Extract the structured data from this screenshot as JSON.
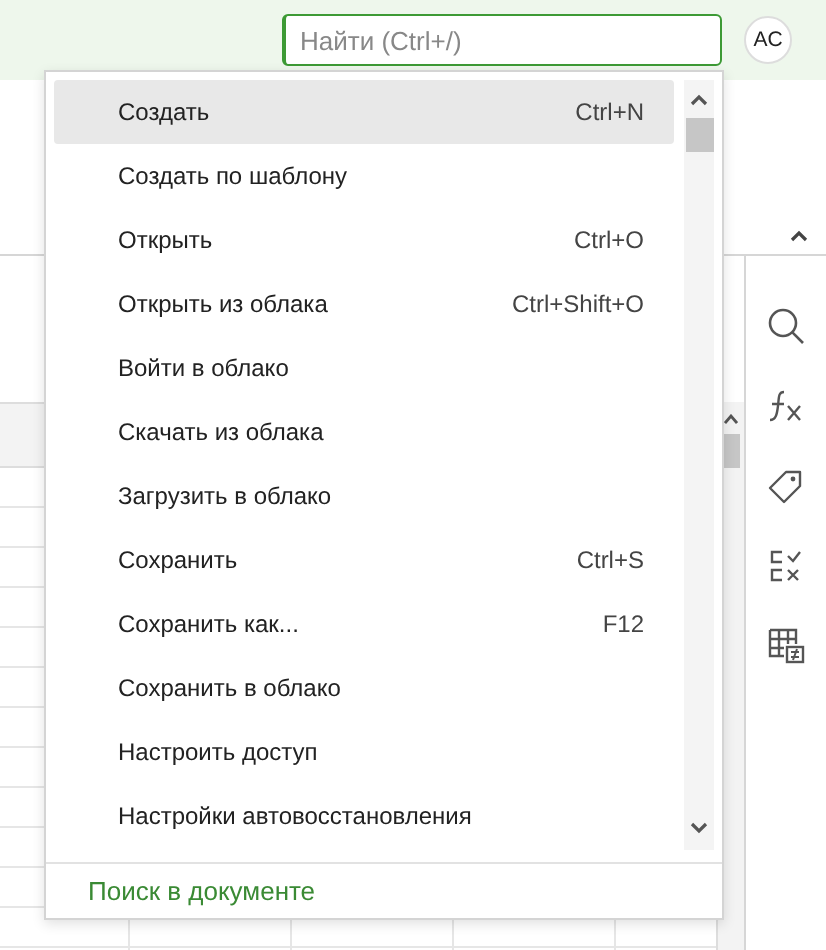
{
  "search": {
    "placeholder": "Найти (Ctrl+/)",
    "focused": true
  },
  "avatar": {
    "initials": "AC"
  },
  "menu": {
    "items": [
      {
        "label": "Создать",
        "shortcut": "Ctrl+N",
        "selected": true
      },
      {
        "label": "Создать по шаблону",
        "selected": false
      },
      {
        "label": "Открыть",
        "shortcut": "Ctrl+O",
        "selected": false
      },
      {
        "label": "Открыть из облака",
        "shortcut": "Ctrl+Shift+O",
        "selected": false
      },
      {
        "label": "Войти в облако",
        "selected": false
      },
      {
        "label": "Скачать из облака",
        "selected": false
      },
      {
        "label": "Загрузить в облако",
        "selected": false
      },
      {
        "label": "Сохранить",
        "shortcut": "Ctrl+S",
        "selected": false
      },
      {
        "label": "Сохранить как...",
        "shortcut": "F12",
        "selected": false
      },
      {
        "label": "Сохранить в облако",
        "selected": false
      },
      {
        "label": "Настроить доступ",
        "selected": false
      },
      {
        "label": "Настройки автовосстановления",
        "selected": false
      }
    ],
    "footer": "Поиск в документе"
  }
}
